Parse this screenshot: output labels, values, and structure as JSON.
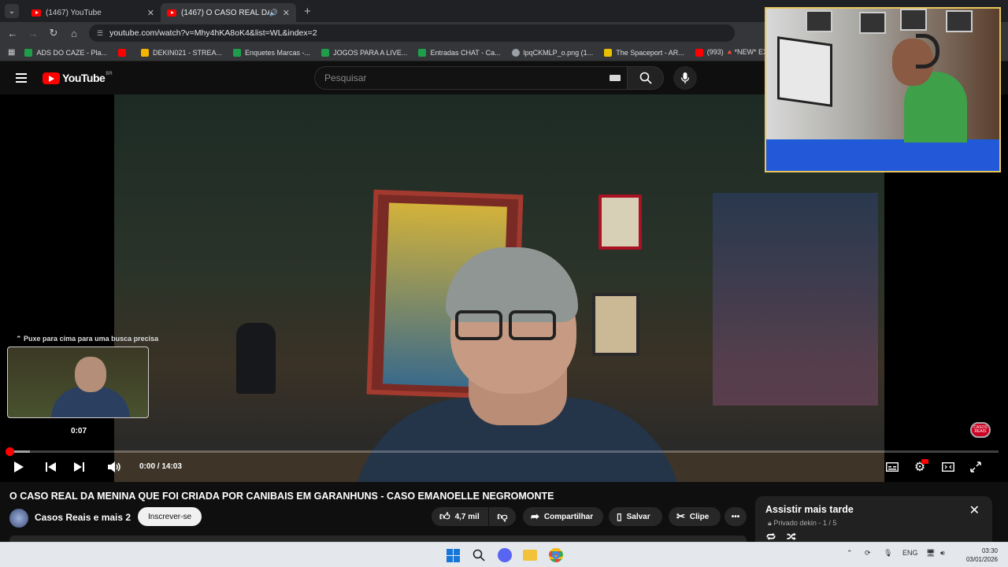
{
  "browser": {
    "tabs": [
      {
        "title": "(1467) YouTube",
        "active": false
      },
      {
        "title": "(1467) O CASO REAL DA M",
        "active": true
      }
    ],
    "url": "youtube.com/watch?v=Mhy4hKA8oK4&list=WL&index=2",
    "bookmarks": [
      {
        "label": "ADS DO CAZE - Pla...",
        "color": "#1e9e4a"
      },
      {
        "label": "",
        "color": "#ff0000"
      },
      {
        "label": "DEKIN021 - STREA...",
        "color": "#f4b400"
      },
      {
        "label": "Enquetes Marcas -...",
        "color": "#1e9e4a"
      },
      {
        "label": "JOGOS PARA A LIVE...",
        "color": "#1e9e4a"
      },
      {
        "label": "Entradas CHAT - Ca...",
        "color": "#1e9e4a"
      },
      {
        "label": "lpqCKMLP_o.png (1...",
        "color": "#9aa0a6"
      },
      {
        "label": "The Spaceport - AR...",
        "color": "#e8c000"
      },
      {
        "label": "(993) 🔺*NEW* EXA...",
        "color": "#ff0000"
      }
    ]
  },
  "youtube": {
    "logo_text": "YouTube",
    "region": "BR",
    "search_placeholder": "Pesquisar"
  },
  "player": {
    "seek_hint": "⌃ Puxe para cima para uma busca precisa",
    "preview_time": "0:07",
    "time_display": "0:00 / 14:03",
    "progress_fraction": 0.0,
    "watermark_text": "CASOS REAIS"
  },
  "video": {
    "title": "O CASO REAL DA MENINA QUE FOI CRIADA POR CANIBAIS EM GARANHUNS - CASO EMANOELLE NEGROMONTE",
    "channel": "Casos Reais e mais 2",
    "subscribe_label": "Inscrever-se",
    "likes": "4,7 mil",
    "share_label": "Compartilhar",
    "save_label": "Salvar",
    "clip_label": "Clipe"
  },
  "watch_later": {
    "title": "Assistir mais tarde",
    "subtitle": "Privado dekin - 1 / 5"
  },
  "taskbar": {
    "lang": "ENG",
    "time": "03:30",
    "date": "03/01/2026"
  },
  "colors": {
    "accent_red": "#ff0000",
    "background": "#0f0f0f",
    "pill": "#272727"
  }
}
